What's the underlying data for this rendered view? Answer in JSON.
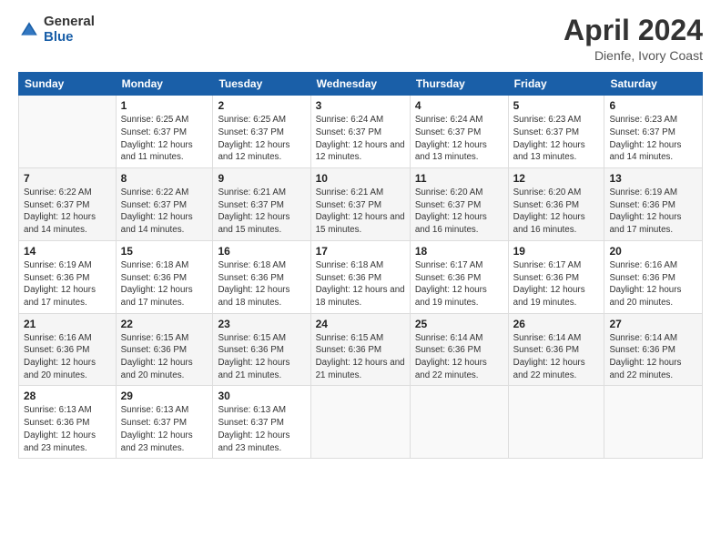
{
  "header": {
    "logo_general": "General",
    "logo_blue": "Blue",
    "title": "April 2024",
    "subtitle": "Dienfe, Ivory Coast"
  },
  "days_of_week": [
    "Sunday",
    "Monday",
    "Tuesday",
    "Wednesday",
    "Thursday",
    "Friday",
    "Saturday"
  ],
  "weeks": [
    [
      {
        "day": "",
        "sunrise": "",
        "sunset": "",
        "daylight": ""
      },
      {
        "day": "1",
        "sunrise": "Sunrise: 6:25 AM",
        "sunset": "Sunset: 6:37 PM",
        "daylight": "Daylight: 12 hours and 11 minutes."
      },
      {
        "day": "2",
        "sunrise": "Sunrise: 6:25 AM",
        "sunset": "Sunset: 6:37 PM",
        "daylight": "Daylight: 12 hours and 12 minutes."
      },
      {
        "day": "3",
        "sunrise": "Sunrise: 6:24 AM",
        "sunset": "Sunset: 6:37 PM",
        "daylight": "Daylight: 12 hours and 12 minutes."
      },
      {
        "day": "4",
        "sunrise": "Sunrise: 6:24 AM",
        "sunset": "Sunset: 6:37 PM",
        "daylight": "Daylight: 12 hours and 13 minutes."
      },
      {
        "day": "5",
        "sunrise": "Sunrise: 6:23 AM",
        "sunset": "Sunset: 6:37 PM",
        "daylight": "Daylight: 12 hours and 13 minutes."
      },
      {
        "day": "6",
        "sunrise": "Sunrise: 6:23 AM",
        "sunset": "Sunset: 6:37 PM",
        "daylight": "Daylight: 12 hours and 14 minutes."
      }
    ],
    [
      {
        "day": "7",
        "sunrise": "Sunrise: 6:22 AM",
        "sunset": "Sunset: 6:37 PM",
        "daylight": "Daylight: 12 hours and 14 minutes."
      },
      {
        "day": "8",
        "sunrise": "Sunrise: 6:22 AM",
        "sunset": "Sunset: 6:37 PM",
        "daylight": "Daylight: 12 hours and 14 minutes."
      },
      {
        "day": "9",
        "sunrise": "Sunrise: 6:21 AM",
        "sunset": "Sunset: 6:37 PM",
        "daylight": "Daylight: 12 hours and 15 minutes."
      },
      {
        "day": "10",
        "sunrise": "Sunrise: 6:21 AM",
        "sunset": "Sunset: 6:37 PM",
        "daylight": "Daylight: 12 hours and 15 minutes."
      },
      {
        "day": "11",
        "sunrise": "Sunrise: 6:20 AM",
        "sunset": "Sunset: 6:37 PM",
        "daylight": "Daylight: 12 hours and 16 minutes."
      },
      {
        "day": "12",
        "sunrise": "Sunrise: 6:20 AM",
        "sunset": "Sunset: 6:36 PM",
        "daylight": "Daylight: 12 hours and 16 minutes."
      },
      {
        "day": "13",
        "sunrise": "Sunrise: 6:19 AM",
        "sunset": "Sunset: 6:36 PM",
        "daylight": "Daylight: 12 hours and 17 minutes."
      }
    ],
    [
      {
        "day": "14",
        "sunrise": "Sunrise: 6:19 AM",
        "sunset": "Sunset: 6:36 PM",
        "daylight": "Daylight: 12 hours and 17 minutes."
      },
      {
        "day": "15",
        "sunrise": "Sunrise: 6:18 AM",
        "sunset": "Sunset: 6:36 PM",
        "daylight": "Daylight: 12 hours and 17 minutes."
      },
      {
        "day": "16",
        "sunrise": "Sunrise: 6:18 AM",
        "sunset": "Sunset: 6:36 PM",
        "daylight": "Daylight: 12 hours and 18 minutes."
      },
      {
        "day": "17",
        "sunrise": "Sunrise: 6:18 AM",
        "sunset": "Sunset: 6:36 PM",
        "daylight": "Daylight: 12 hours and 18 minutes."
      },
      {
        "day": "18",
        "sunrise": "Sunrise: 6:17 AM",
        "sunset": "Sunset: 6:36 PM",
        "daylight": "Daylight: 12 hours and 19 minutes."
      },
      {
        "day": "19",
        "sunrise": "Sunrise: 6:17 AM",
        "sunset": "Sunset: 6:36 PM",
        "daylight": "Daylight: 12 hours and 19 minutes."
      },
      {
        "day": "20",
        "sunrise": "Sunrise: 6:16 AM",
        "sunset": "Sunset: 6:36 PM",
        "daylight": "Daylight: 12 hours and 20 minutes."
      }
    ],
    [
      {
        "day": "21",
        "sunrise": "Sunrise: 6:16 AM",
        "sunset": "Sunset: 6:36 PM",
        "daylight": "Daylight: 12 hours and 20 minutes."
      },
      {
        "day": "22",
        "sunrise": "Sunrise: 6:15 AM",
        "sunset": "Sunset: 6:36 PM",
        "daylight": "Daylight: 12 hours and 20 minutes."
      },
      {
        "day": "23",
        "sunrise": "Sunrise: 6:15 AM",
        "sunset": "Sunset: 6:36 PM",
        "daylight": "Daylight: 12 hours and 21 minutes."
      },
      {
        "day": "24",
        "sunrise": "Sunrise: 6:15 AM",
        "sunset": "Sunset: 6:36 PM",
        "daylight": "Daylight: 12 hours and 21 minutes."
      },
      {
        "day": "25",
        "sunrise": "Sunrise: 6:14 AM",
        "sunset": "Sunset: 6:36 PM",
        "daylight": "Daylight: 12 hours and 22 minutes."
      },
      {
        "day": "26",
        "sunrise": "Sunrise: 6:14 AM",
        "sunset": "Sunset: 6:36 PM",
        "daylight": "Daylight: 12 hours and 22 minutes."
      },
      {
        "day": "27",
        "sunrise": "Sunrise: 6:14 AM",
        "sunset": "Sunset: 6:36 PM",
        "daylight": "Daylight: 12 hours and 22 minutes."
      }
    ],
    [
      {
        "day": "28",
        "sunrise": "Sunrise: 6:13 AM",
        "sunset": "Sunset: 6:36 PM",
        "daylight": "Daylight: 12 hours and 23 minutes."
      },
      {
        "day": "29",
        "sunrise": "Sunrise: 6:13 AM",
        "sunset": "Sunset: 6:37 PM",
        "daylight": "Daylight: 12 hours and 23 minutes."
      },
      {
        "day": "30",
        "sunrise": "Sunrise: 6:13 AM",
        "sunset": "Sunset: 6:37 PM",
        "daylight": "Daylight: 12 hours and 23 minutes."
      },
      {
        "day": "",
        "sunrise": "",
        "sunset": "",
        "daylight": ""
      },
      {
        "day": "",
        "sunrise": "",
        "sunset": "",
        "daylight": ""
      },
      {
        "day": "",
        "sunrise": "",
        "sunset": "",
        "daylight": ""
      },
      {
        "day": "",
        "sunrise": "",
        "sunset": "",
        "daylight": ""
      }
    ]
  ]
}
